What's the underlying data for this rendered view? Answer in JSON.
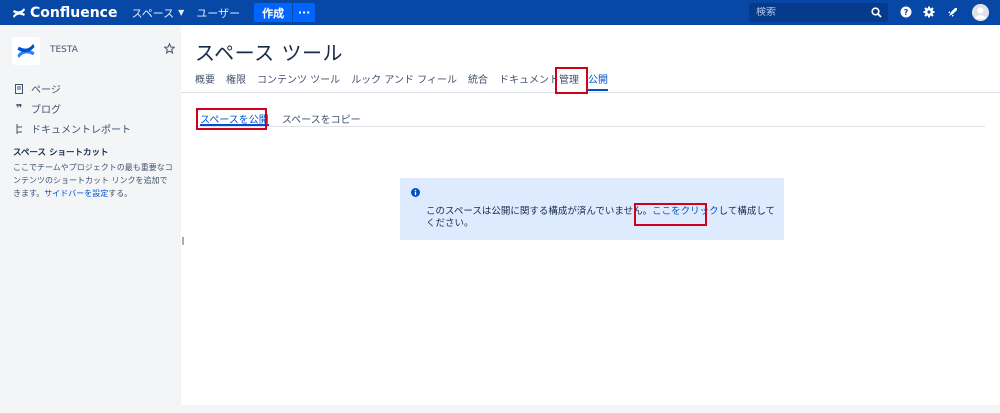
{
  "topnav": {
    "app_name": "Confluence",
    "spaces_label": "スペース",
    "users_label": "ユーザー",
    "create_label": "作成",
    "more_label": "···",
    "search_placeholder": "検索",
    "brand_color": "#0747a6"
  },
  "sidebar": {
    "space_name": "TESTA",
    "links": [
      {
        "label": "ページ",
        "icon": "page-icon"
      },
      {
        "label": "ブログ",
        "icon": "quote-icon"
      },
      {
        "label": "ドキュメントレポート",
        "icon": "tree-icon"
      }
    ],
    "shortcuts_title": "スペース ショートカット",
    "shortcuts_text_before": "ここでチームやプロジェクトの最も重要なコンテンツのショートカット リンクを追加できます。",
    "shortcuts_link": "サイドバーを設定",
    "shortcuts_text_after": "する。"
  },
  "main": {
    "title": "スペース ツール",
    "tabs": [
      {
        "label": "概要"
      },
      {
        "label": "権限"
      },
      {
        "label": "コンテンツ ツール"
      },
      {
        "label": "ルック アンド フィール"
      },
      {
        "label": "統合"
      },
      {
        "label": "ドキュメント管理"
      },
      {
        "label": "公開",
        "active": true
      }
    ],
    "subtabs": [
      {
        "label": "スペースを公開",
        "active": true
      },
      {
        "label": "スペースをコピー"
      }
    ],
    "info": {
      "text_before": "このスペースは公開に関する構成が済んでいません。",
      "link": "ここをクリック",
      "text_after": "して構成してください。"
    }
  },
  "colors": {
    "highlight": "#d0021b",
    "link": "#0052cc",
    "info_bg": "#deebff"
  }
}
